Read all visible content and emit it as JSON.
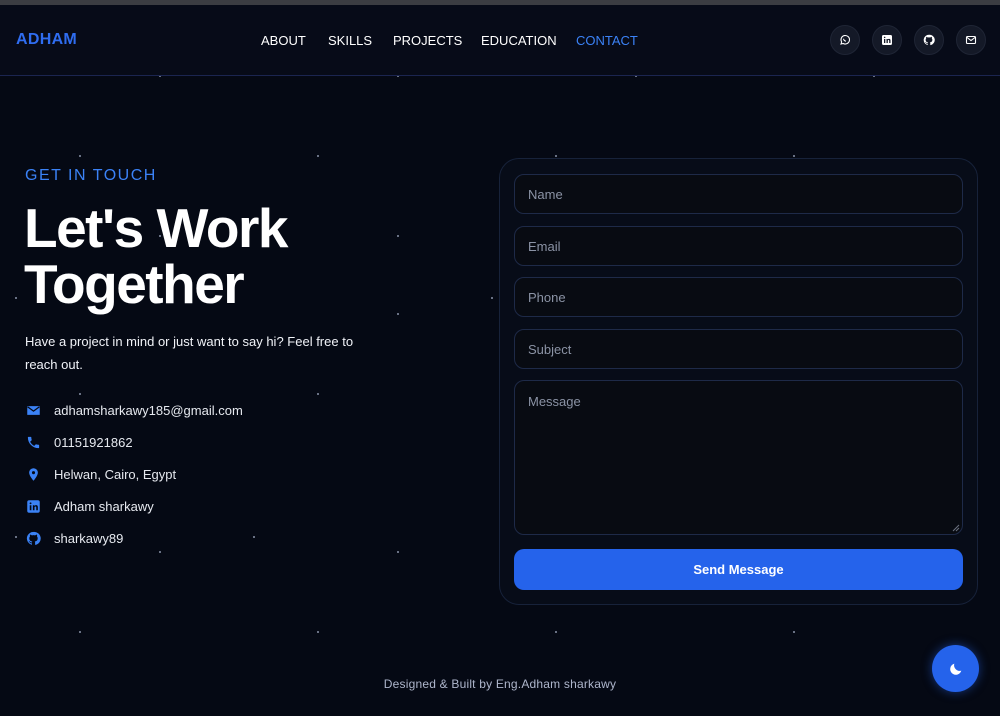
{
  "header": {
    "logo": "ADHAM",
    "nav": [
      {
        "label": "ABOUT"
      },
      {
        "label": "SKILLS"
      },
      {
        "label": "PROJECTS"
      },
      {
        "label": "EDUCATION"
      },
      {
        "label": "CONTACT",
        "active": true
      }
    ],
    "socials": [
      {
        "icon": "whatsapp-icon"
      },
      {
        "icon": "linkedin-icon"
      },
      {
        "icon": "github-icon"
      },
      {
        "icon": "mail-icon"
      }
    ]
  },
  "contact": {
    "eyebrow": "GET IN TOUCH",
    "title_line1": "Let's Work",
    "title_line2": "Together",
    "intro": "Have a project in mind or just want to say hi? Feel free to reach out.",
    "items": [
      {
        "icon": "envelope-icon",
        "text": "adhamsharkawy185@gmail.com"
      },
      {
        "icon": "phone-icon",
        "text": "01151921862"
      },
      {
        "icon": "location-pin-icon",
        "text": "Helwan, Cairo, Egypt"
      },
      {
        "icon": "linkedin-icon",
        "text": "Adham sharkawy"
      },
      {
        "icon": "github-icon",
        "text": "sharkawy89"
      }
    ]
  },
  "form": {
    "name_placeholder": "Name",
    "email_placeholder": "Email",
    "phone_placeholder": "Phone",
    "subject_placeholder": "Subject",
    "message_placeholder": "Message",
    "submit_label": "Send Message"
  },
  "footer": {
    "credit": "Designed & Built by Eng.Adham sharkawy"
  },
  "theme": {
    "accent": "#2563eb",
    "background": "#050914",
    "toggle_icon": "moon-icon"
  }
}
